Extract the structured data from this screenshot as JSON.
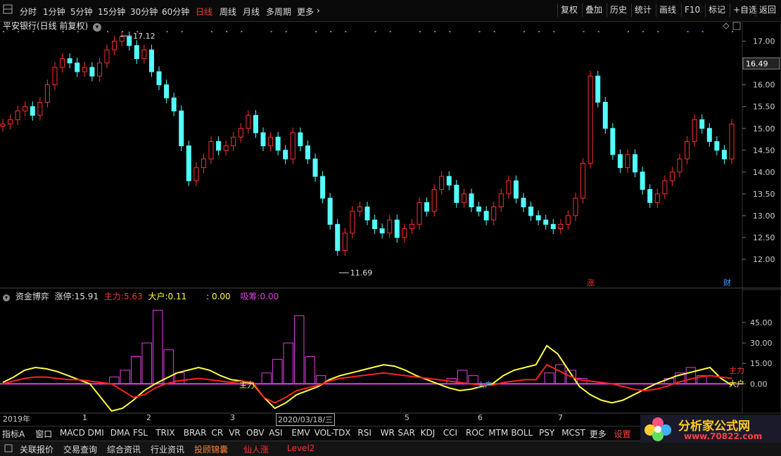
{
  "toolbar": {
    "periods": [
      "分时",
      "1分钟",
      "5分钟",
      "15分钟",
      "30分钟",
      "60分钟",
      "日线",
      "周线",
      "月线",
      "多周期",
      "更多"
    ],
    "active": "日线",
    "right": [
      "复权",
      "叠加",
      "历史",
      "统计",
      "画线",
      "F10",
      "标记",
      "+自选",
      "返回"
    ]
  },
  "header": {
    "title": "平安银行(日线 前复权)"
  },
  "price_axis": {
    "ticks": [
      "17.00",
      "16.50",
      "16.00",
      "15.50",
      "15.00",
      "14.50",
      "14.00",
      "13.50",
      "13.00",
      "12.50",
      "12.00"
    ],
    "current": "16.49"
  },
  "annotations": {
    "high": "17.12",
    "low": "11.69",
    "zhang": "涨",
    "cai": "财"
  },
  "indicator": {
    "name": "资金博弈",
    "zt_label": "涨停:",
    "zt_value": "15.91",
    "zl_label": "主力:",
    "zl_value": "5.63",
    "dh_label": "大户:",
    "dh_value": "0.11",
    "x_value": ": 0.00",
    "xc_label": "吸筹:",
    "xc_value": "0.00",
    "line_label_main": "主力",
    "line_label_big": "大户",
    "ticks": [
      "45.00",
      "30.00",
      "15.00",
      "0.00"
    ],
    "right_main": "主力",
    "right_big": "大户"
  },
  "dates": [
    "2019年",
    "1",
    "2",
    "3",
    "2020/03/18/三",
    "5",
    "6",
    "7"
  ],
  "tabs": [
    "指标A",
    "窗口",
    "MACD",
    "DMI",
    "DMA",
    "FSL",
    "TRIX",
    "BRAR",
    "CR",
    "VR",
    "OBV",
    "ASI",
    "EMV",
    "VOL-TDX",
    "RSI",
    "WR",
    "SAR",
    "KDJ",
    "CCI",
    "ROC",
    "MTM",
    "BOLL",
    "PSY",
    "MCST",
    "更多",
    "设置"
  ],
  "bottom": [
    "关联报价",
    "交易查询",
    "综合资讯",
    "行业资讯",
    "投顾锦囊",
    "仙人涨",
    "Level2"
  ],
  "logo": {
    "line1": "分析家公式网",
    "line2": "www.70822.com"
  },
  "colors": {
    "up": "#ff3030",
    "down": "#54ffff",
    "magenta": "#e040e0",
    "yellow": "#ffff40",
    "red_line": "#ff2020"
  },
  "chart_data": [
    {
      "type": "candlestick",
      "title": "平安银行(日线 前复权)",
      "ylim": [
        11.5,
        17.3
      ],
      "y_ticks": [
        12.0,
        12.5,
        13.0,
        13.5,
        14.0,
        14.5,
        15.0,
        15.5,
        16.0,
        16.5,
        17.0
      ],
      "close": [
        15.1,
        15.2,
        15.4,
        15.5,
        15.3,
        15.6,
        16.0,
        16.4,
        16.6,
        16.5,
        16.3,
        16.4,
        16.2,
        16.5,
        16.8,
        17.0,
        17.1,
        16.9,
        16.6,
        16.8,
        16.3,
        16.0,
        15.7,
        15.4,
        14.6,
        13.8,
        14.1,
        14.3,
        14.7,
        14.5,
        14.6,
        14.8,
        15.0,
        15.3,
        14.9,
        14.6,
        14.8,
        14.5,
        14.3,
        14.9,
        14.6,
        14.3,
        13.9,
        13.4,
        12.8,
        12.2,
        12.6,
        13.1,
        13.2,
        12.9,
        12.7,
        12.6,
        12.9,
        12.5,
        12.7,
        12.8,
        13.3,
        13.1,
        13.6,
        13.9,
        13.7,
        13.3,
        13.5,
        13.2,
        13.1,
        12.9,
        13.2,
        13.5,
        13.8,
        13.4,
        13.2,
        13.0,
        12.9,
        12.8,
        12.7,
        12.8,
        13.0,
        13.4,
        14.2,
        16.2,
        15.6,
        15.0,
        14.4,
        14.1,
        14.4,
        14.0,
        13.6,
        13.3,
        13.5,
        13.8,
        14.0,
        14.3,
        14.7,
        15.2,
        15.0,
        14.7,
        14.5,
        14.3,
        15.1
      ],
      "high": 17.12,
      "low": 11.69,
      "last": 16.49
    },
    {
      "type": "line+bar",
      "title": "资金博弈",
      "ylim": [
        -20,
        60
      ],
      "y_ticks": [
        0,
        15,
        30,
        45
      ],
      "series": [
        {
          "name": "主力",
          "values": [
            0,
            2,
            4,
            5,
            5,
            4,
            3,
            3,
            2,
            1,
            0,
            -5,
            -10,
            -8,
            -3,
            0,
            2,
            3,
            4,
            3,
            2,
            1,
            2,
            1,
            -10,
            -14,
            -10,
            -5,
            -3,
            -1,
            2,
            4,
            5,
            6,
            7,
            8,
            7,
            6,
            5,
            4,
            3,
            2,
            1,
            0,
            -1,
            -1,
            1,
            2,
            3,
            3,
            14,
            10,
            6,
            3,
            2,
            1,
            0,
            -2,
            -4,
            -5,
            -4,
            -2,
            1,
            3,
            5,
            6,
            5,
            4
          ]
        },
        {
          "name": "大户",
          "values": [
            1,
            5,
            10,
            12,
            11,
            9,
            6,
            3,
            0,
            -10,
            -20,
            -18,
            -12,
            -5,
            0,
            4,
            8,
            10,
            12,
            10,
            6,
            3,
            2,
            0,
            -10,
            -18,
            -14,
            -8,
            -5,
            -2,
            3,
            6,
            8,
            10,
            12,
            14,
            13,
            10,
            6,
            3,
            0,
            -3,
            -5,
            -4,
            -2,
            0,
            6,
            10,
            12,
            14,
            28,
            22,
            10,
            -2,
            -8,
            -12,
            -14,
            -12,
            -8,
            -4,
            0,
            3,
            6,
            8,
            10,
            12,
            4,
            -1
          ]
        },
        {
          "name": "涨停",
          "values": [
            0,
            0,
            0,
            0,
            0,
            0,
            0,
            0,
            0,
            0,
            5,
            10,
            20,
            30,
            54,
            25,
            8,
            0,
            0,
            0,
            0,
            0,
            0,
            0,
            8,
            18,
            30,
            50,
            20,
            6,
            0,
            0,
            0,
            0,
            0,
            0,
            0,
            0,
            0,
            0,
            0,
            4,
            10,
            6,
            0,
            0,
            0,
            0,
            0,
            0,
            8,
            14,
            10,
            4,
            0,
            0,
            0,
            0,
            0,
            0,
            0,
            4,
            8,
            12,
            6,
            0,
            0,
            0
          ]
        }
      ]
    }
  ]
}
